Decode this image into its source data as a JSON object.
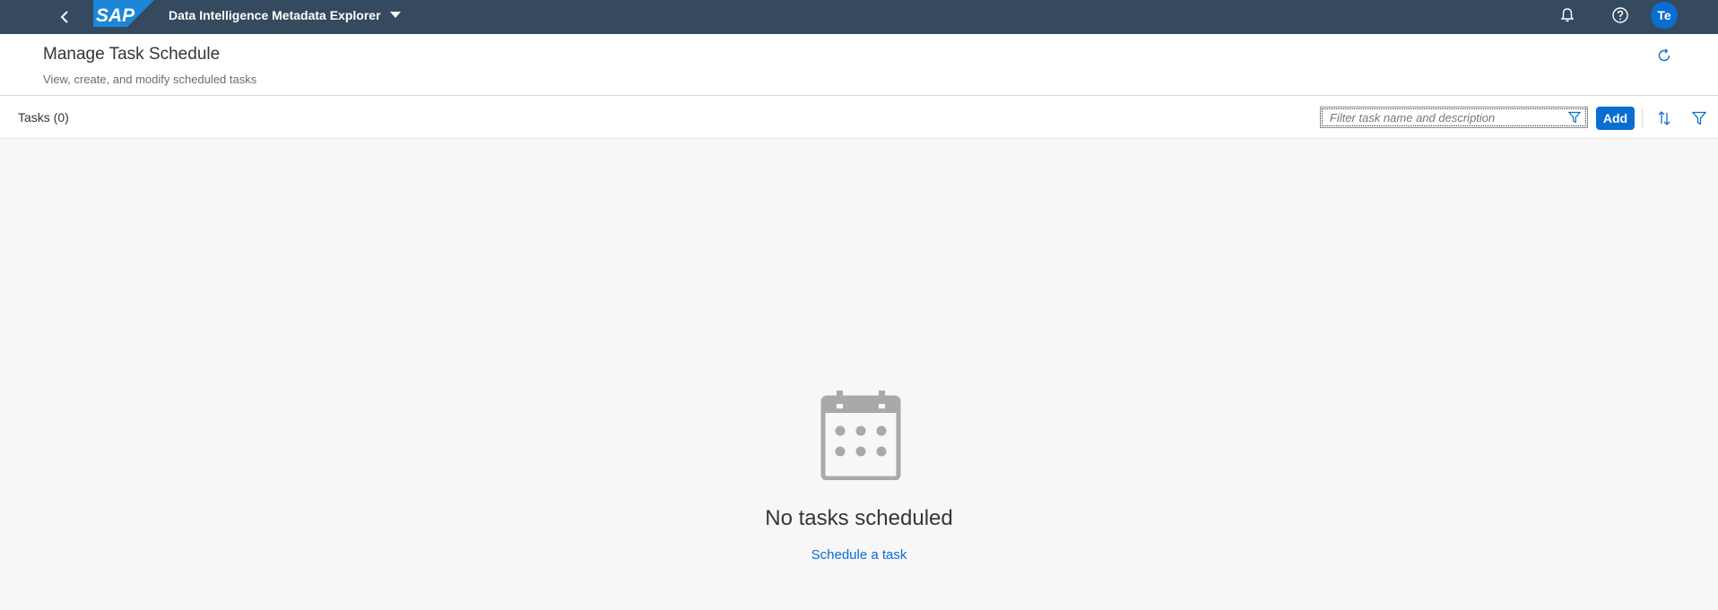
{
  "shell": {
    "app_title": "Data Intelligence Metadata Explorer",
    "logo_text": "SAP",
    "avatar_initials": "Te",
    "icons": {
      "back": "chevron-left-icon",
      "dropdown": "caret-down-icon",
      "notifications": "bell-icon",
      "help": "question-circle-icon"
    },
    "background_color": "#354a5f"
  },
  "header": {
    "title": "Manage Task Schedule",
    "subtitle": "View, create, and modify scheduled tasks",
    "refresh_icon": "refresh-icon"
  },
  "toolbar": {
    "tasks_label": "Tasks (0)",
    "filter_placeholder": "Filter task name and description",
    "filter_value": "",
    "add_label": "Add",
    "sort_icon": "sort-icon",
    "filter_icon": "filter-icon"
  },
  "empty_state": {
    "icon": "calendar-icon",
    "title": "No tasks scheduled",
    "link": "Schedule a task"
  },
  "colors": {
    "accent": "#0a6ed1",
    "shell": "#354a5f",
    "page_background": "#f7f7f7",
    "icon_gray": "#a9a9a9"
  }
}
